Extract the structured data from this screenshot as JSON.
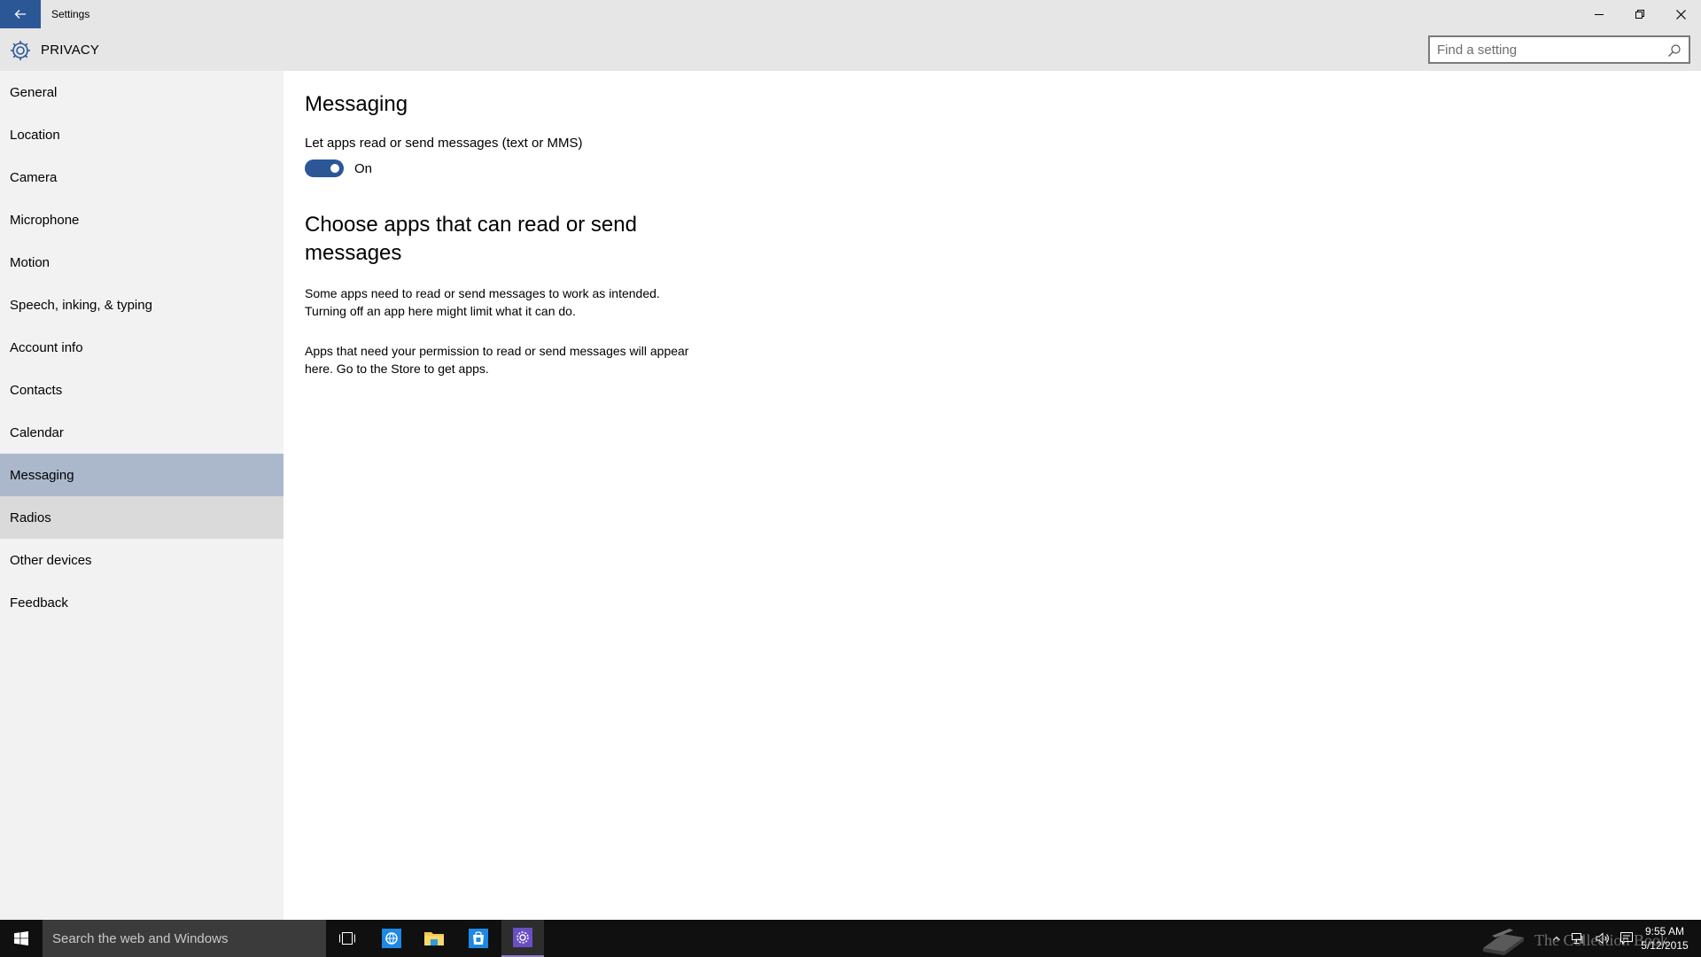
{
  "window": {
    "title": "Settings",
    "accent_color": "#2b5797",
    "icons": [
      "back-arrow-icon",
      "minimize-icon",
      "restore-icon",
      "close-icon"
    ]
  },
  "header": {
    "title": "PRIVACY",
    "icon": "gear-icon",
    "search": {
      "placeholder": "Find a setting",
      "value": "",
      "icon": "search-icon"
    }
  },
  "sidebar": {
    "selected": "Messaging",
    "hovered": "Radios",
    "items": [
      {
        "label": "General"
      },
      {
        "label": "Location"
      },
      {
        "label": "Camera"
      },
      {
        "label": "Microphone"
      },
      {
        "label": "Motion"
      },
      {
        "label": "Speech, inking, & typing"
      },
      {
        "label": "Account info"
      },
      {
        "label": "Contacts"
      },
      {
        "label": "Calendar"
      },
      {
        "label": "Messaging"
      },
      {
        "label": "Radios"
      },
      {
        "label": "Other devices"
      },
      {
        "label": "Feedback"
      }
    ]
  },
  "main": {
    "title": "Messaging",
    "toggle": {
      "label": "Let apps read or send messages (text or MMS)",
      "state": "On",
      "on": true
    },
    "section_title": "Choose apps that can read or send messages",
    "paragraphs": [
      "Some apps need to read or send messages to work as intended. Turning off an app here might limit what it can do.",
      "Apps that need your permission to read or send messages will appear here. Go to the Store to get apps."
    ]
  },
  "taskbar": {
    "search_placeholder": "Search the web and Windows",
    "apps": [
      "task-view-icon",
      "internet-explorer-icon",
      "file-explorer-icon",
      "store-icon",
      "settings-icon"
    ],
    "active_app": "settings-icon",
    "tray_icons": [
      "show-hidden-icons-chevron-icon",
      "network-icon",
      "volume-icon",
      "action-center-icon"
    ],
    "watermark_text": "The Collection Book",
    "clock": {
      "time": "9:55 AM",
      "date": "5/12/2015"
    }
  }
}
